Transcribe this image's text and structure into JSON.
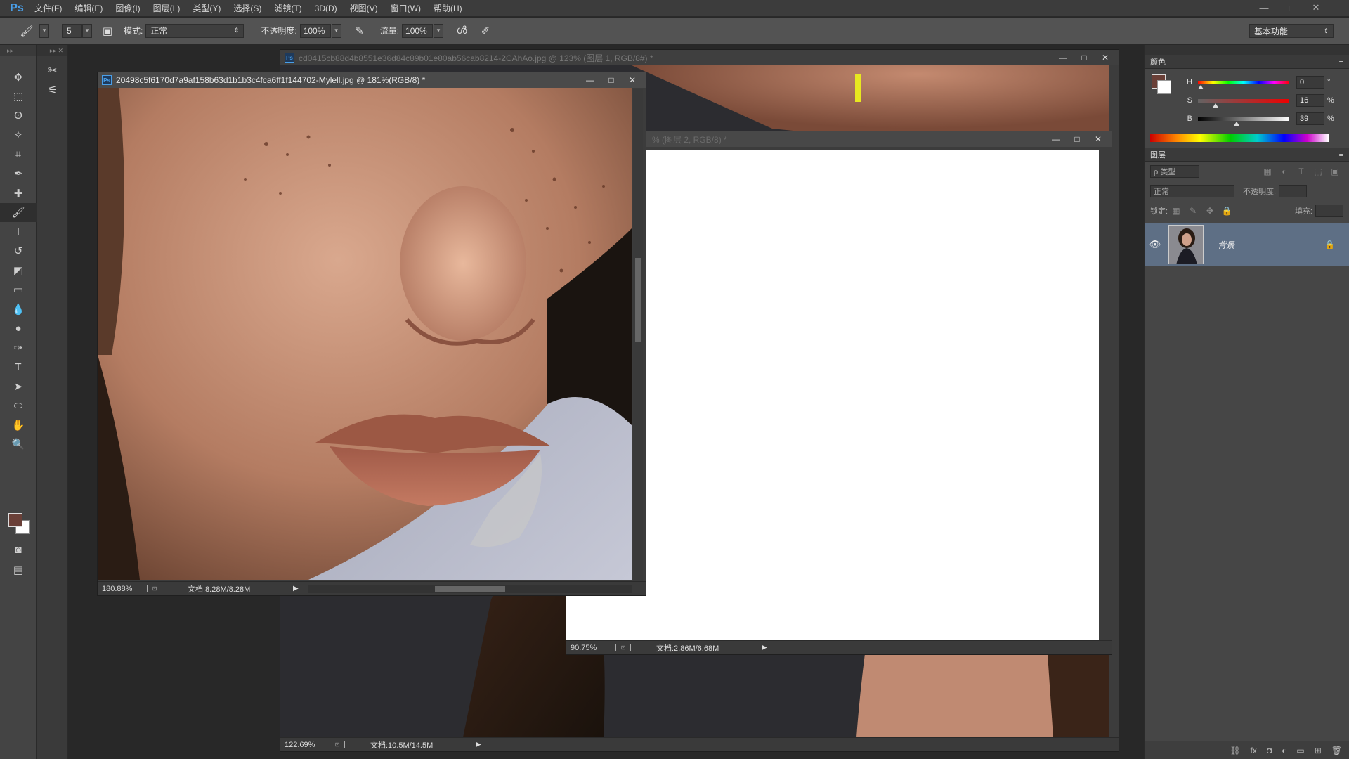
{
  "app": {
    "logo": "Ps",
    "menu": [
      "文件(F)",
      "编辑(E)",
      "图像(I)",
      "图层(L)",
      "类型(Y)",
      "选择(S)",
      "滤镜(T)",
      "3D(D)",
      "视图(V)",
      "窗口(W)",
      "帮助(H)"
    ],
    "window_controls": [
      "—",
      "□",
      "✕"
    ]
  },
  "options": {
    "brush_size": "5",
    "mode_label": "模式:",
    "mode_value": "正常",
    "opacity_label": "不透明度:",
    "opacity_value": "100%",
    "flow_label": "流量:",
    "flow_value": "100%",
    "workspace": "基本功能"
  },
  "documents": {
    "back": {
      "title": "cd0415cb88d4b8551e36d84c89b01e80ab56cab8214-2CAhAo.jpg @ 123% (图层 1, RGB/8#) *",
      "zoom": "122.69%",
      "doc_size": "文档:10.5M/14.5M"
    },
    "middle": {
      "title": "% (图层 2, RGB/8) *",
      "zoom": "90.75%",
      "doc_size": "文档:2.86M/6.68M"
    },
    "front": {
      "title": "20498c5f6170d7a9af158b63d1b1b3c4fca6ff1f144702-Mylell.jpg @ 181%(RGB/8) *",
      "zoom": "180.88%",
      "doc_size": "文档:8.28M/8.28M"
    }
  },
  "color_panel": {
    "tab": "颜色",
    "h_label": "H",
    "h_value": "0",
    "h_unit": "°",
    "h_level": 0.0,
    "s_label": "S",
    "s_value": "16",
    "s_unit": "%",
    "s_level": 0.16,
    "b_label": "B",
    "b_value": "39",
    "b_unit": "%",
    "b_level": 0.39,
    "foreground_color": "#6a4038",
    "background_color": "#ffffff"
  },
  "layers_panel": {
    "tab": "图层",
    "filter_label": "ρ 类型",
    "blend_mode": "正常",
    "opacity_label": "不透明度:",
    "lock_label": "锁定:",
    "fill_label": "填充:",
    "layers": [
      {
        "name": "背景",
        "selected": true,
        "locked": true
      }
    ],
    "selected_color": "#5e6f85"
  },
  "icons": {
    "tools": [
      "move-icon",
      "marquee-icon",
      "lasso-icon",
      "magic-wand-icon",
      "crop-icon",
      "eyedropper-icon",
      "healing-brush-icon",
      "brush-icon",
      "clone-stamp-icon",
      "history-brush-icon",
      "eraser-icon",
      "gradient-icon",
      "blur-icon",
      "dodge-icon",
      "pen-icon",
      "type-icon",
      "path-select-icon",
      "ellipse-icon",
      "hand-3d-icon",
      "zoom-icon"
    ]
  }
}
